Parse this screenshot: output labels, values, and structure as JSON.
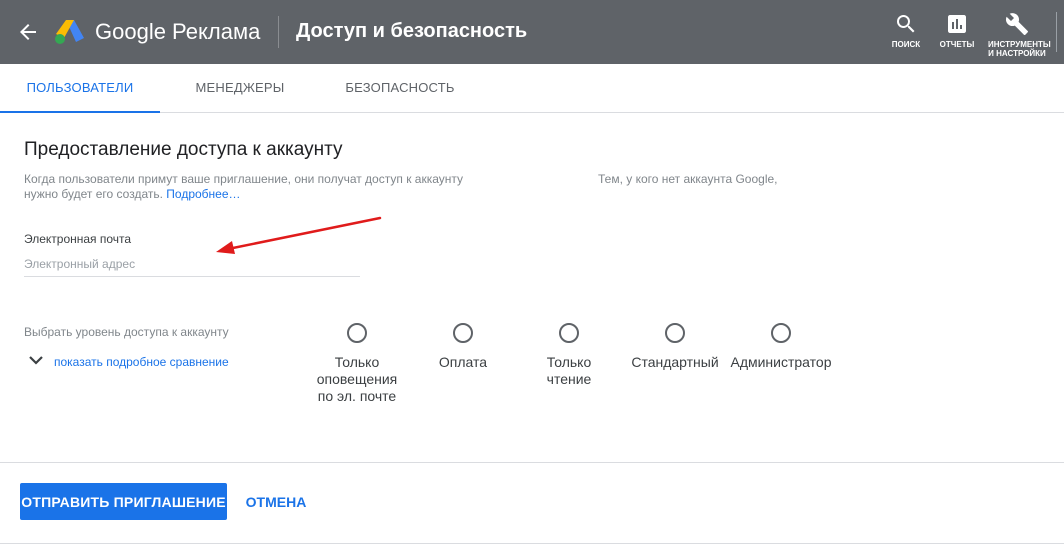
{
  "header": {
    "brand": "Google Реклама",
    "title": "Доступ и безопасность",
    "tools": [
      {
        "label": "ПОИСК",
        "icon": "search-icon"
      },
      {
        "label": "ОТЧЕТЫ",
        "icon": "reports-icon"
      },
      {
        "label": "ИНСТРУМЕНТЫ И НАСТРОЙКИ",
        "icon": "wrench-icon"
      }
    ]
  },
  "tabs": [
    {
      "label": "ПОЛЬЗОВАТЕЛИ",
      "active": true
    },
    {
      "label": "МЕНЕДЖЕРЫ",
      "active": false
    },
    {
      "label": "БЕЗОПАСНОСТЬ",
      "active": false
    }
  ],
  "invite": {
    "title": "Предоставление доступа к аккаунту",
    "desc_line1": "Когда пользователи примут ваше приглашение, они получат доступ к аккаунту",
    "desc_line2": "нужно будет его создать.",
    "desc_link": "Подробнее…",
    "desc_right": "Тем, у кого нет аккаунта Google,",
    "email_label": "Электронная почта",
    "email_placeholder": "Электронный адрес",
    "email_value": ""
  },
  "access": {
    "label": "Выбрать уровень доступа к аккаунту",
    "compare_link": "показать подробное сравнение",
    "options": [
      {
        "label": "Только оповещения по эл. почте",
        "selected": false
      },
      {
        "label": "Оплата",
        "selected": false
      },
      {
        "label": "Только чтение",
        "selected": false
      },
      {
        "label": "Стандартный",
        "selected": false
      },
      {
        "label": "Администратор",
        "selected": false
      }
    ]
  },
  "actions": {
    "send_label": "ОТПРАВИТЬ ПРИГЛАШЕНИЕ",
    "cancel_label": "ОТМЕНА"
  },
  "colors": {
    "header_bg": "#5f6368",
    "accent": "#1a73e8",
    "annotation_arrow": "#e01b1b"
  }
}
